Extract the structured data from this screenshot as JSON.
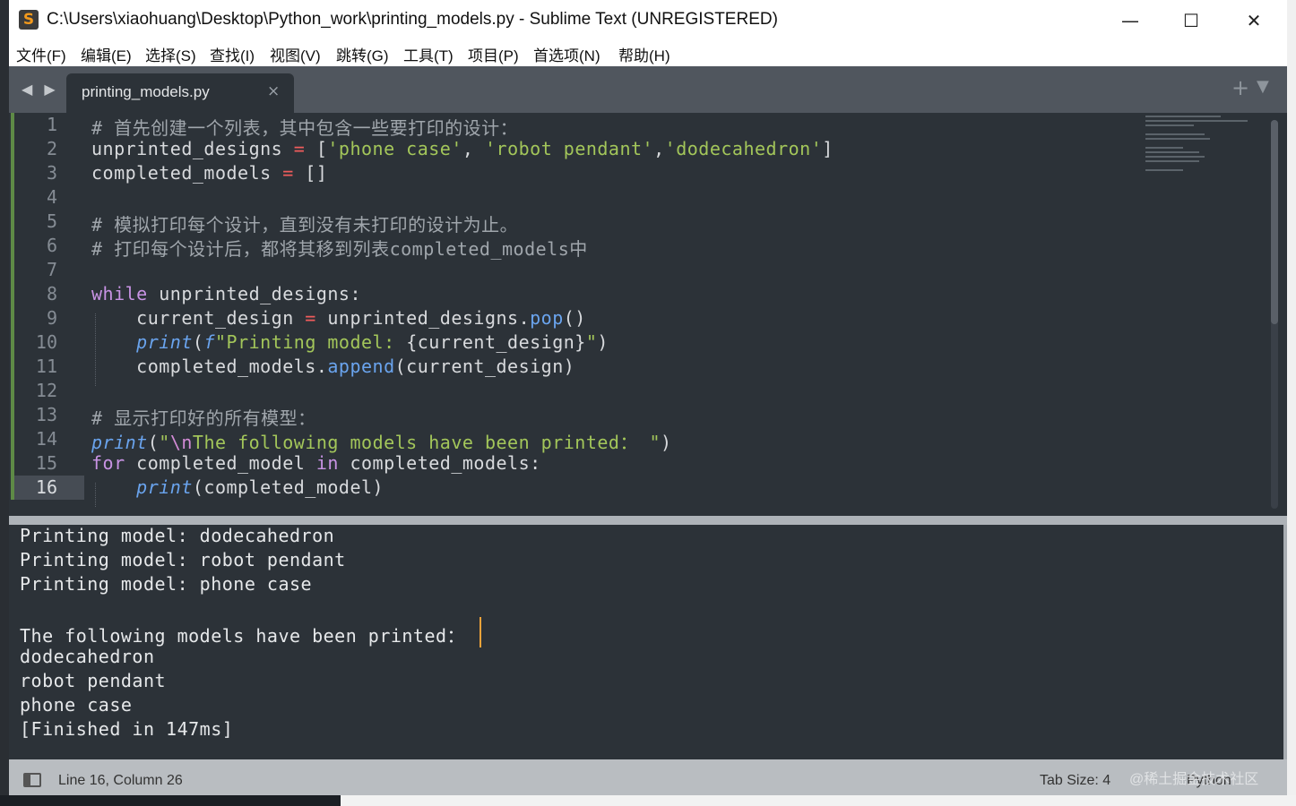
{
  "window": {
    "title": "C:\\Users\\xiaohuang\\Desktop\\Python_work\\printing_models.py - Sublime Text (UNREGISTERED)",
    "app_icon": "S",
    "controls": {
      "minimize": "—",
      "maximize": "☐",
      "close": "✕"
    }
  },
  "menu": [
    "文件(F)",
    "编辑(E)",
    "选择(S)",
    "查找(I)",
    "视图(V)",
    "跳转(G)",
    "工具(T)",
    "项目(P)",
    "首选项(N)",
    "帮助(H)"
  ],
  "tabs": {
    "nav_arrows": "◀ ▶",
    "active": "printing_models.py",
    "close_icon": "×",
    "add_icon": "+",
    "menu_icon": "▼"
  },
  "editor": {
    "line_numbers": [
      "1",
      "2",
      "3",
      "4",
      "5",
      "6",
      "7",
      "8",
      "9",
      "10",
      "11",
      "12",
      "13",
      "14",
      "15",
      "16"
    ],
    "current_line": 16,
    "lines": [
      [
        [
          "c-comment",
          "# 首先创建一个列表，其中包含一些要打印的设计："
        ]
      ],
      [
        [
          "",
          "unprinted_designs "
        ],
        [
          "c-op",
          "="
        ],
        [
          "",
          " ["
        ],
        [
          "c-str",
          "'phone case'"
        ],
        [
          "",
          ", "
        ],
        [
          "c-str",
          "'robot pendant'"
        ],
        [
          "",
          ","
        ],
        [
          "c-str",
          "'dodecahedron'"
        ],
        [
          "",
          "]"
        ]
      ],
      [
        [
          "",
          "completed_models "
        ],
        [
          "c-op",
          "="
        ],
        [
          "",
          " []"
        ]
      ],
      [],
      [
        [
          "c-comment",
          "# 模拟打印每个设计，直到没有未打印的设计为止。"
        ]
      ],
      [
        [
          "c-comment",
          "# 打印每个设计后，都将其移到列表completed_models中"
        ]
      ],
      [],
      [
        [
          "c-kw",
          "while"
        ],
        [
          "",
          " unprinted_designs:"
        ]
      ],
      [
        [
          "",
          "    current_design "
        ],
        [
          "c-op",
          "="
        ],
        [
          "",
          " unprinted_designs."
        ],
        [
          "c-meth",
          "pop"
        ],
        [
          "",
          "()"
        ]
      ],
      [
        [
          "",
          "    "
        ],
        [
          "c-fn",
          "print"
        ],
        [
          "",
          "("
        ],
        [
          "c-fn",
          "f"
        ],
        [
          "c-str",
          "\"Printing model: "
        ],
        [
          "",
          "{current_design}"
        ],
        [
          "c-str",
          "\""
        ],
        [
          "",
          ")"
        ]
      ],
      [
        [
          "",
          "    completed_models."
        ],
        [
          "c-meth",
          "append"
        ],
        [
          "",
          "(current_design)"
        ]
      ],
      [],
      [
        [
          "c-comment",
          "# 显示打印好的所有模型："
        ]
      ],
      [
        [
          "c-fn",
          "print"
        ],
        [
          "",
          "("
        ],
        [
          "c-str",
          "\""
        ],
        [
          "c-esc",
          "\\n"
        ],
        [
          "c-str",
          "The following models have been printed： \""
        ],
        [
          "",
          ")"
        ]
      ],
      [
        [
          "c-kw",
          "for"
        ],
        [
          "",
          " completed_model "
        ],
        [
          "c-kw",
          "in"
        ],
        [
          "",
          " completed_models:"
        ]
      ],
      [
        [
          "",
          "    "
        ],
        [
          "c-fn",
          "print"
        ],
        [
          "",
          "(completed_model)"
        ]
      ]
    ]
  },
  "output": {
    "lines": [
      "Printing model: dodecahedron",
      "Printing model: robot pendant",
      "Printing model: phone case",
      "",
      "The following models have been printed：",
      "dodecahedron",
      "robot pendant",
      "phone case",
      "[Finished in 147ms]"
    ]
  },
  "status": {
    "position": "Line 16, Column 26",
    "tab_size": "Tab Size: 4",
    "syntax": "Python",
    "watermark": "@稀土掘金技术社区"
  }
}
